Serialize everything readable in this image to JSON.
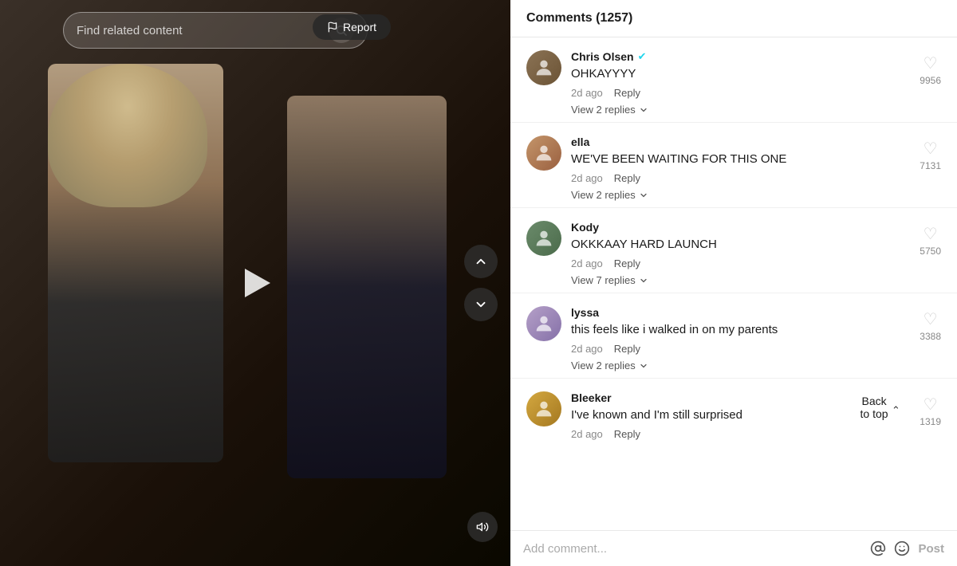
{
  "search": {
    "placeholder": "Find related content"
  },
  "report_button": "Report",
  "comments": {
    "header": "Comments (1257)",
    "list": [
      {
        "id": "chris",
        "username": "Chris Olsen",
        "verified": true,
        "avatar_emoji": "👤",
        "text": "OHKAYYYY",
        "time": "2d ago",
        "reply_label": "Reply",
        "view_replies": "View 2 replies",
        "likes": "9956"
      },
      {
        "id": "ella",
        "username": "ella",
        "verified": false,
        "avatar_emoji": "👤",
        "text": "WE'VE BEEN WAITING FOR THIS ONE",
        "time": "2d ago",
        "reply_label": "Reply",
        "view_replies": "View 2 replies",
        "likes": "7131"
      },
      {
        "id": "kody",
        "username": "Kody",
        "verified": false,
        "avatar_emoji": "👤",
        "text": "OKKKAAY HARD LAUNCH",
        "time": "2d ago",
        "reply_label": "Reply",
        "view_replies": "View 7 replies",
        "likes": "5750"
      },
      {
        "id": "lyssa",
        "username": "lyssa",
        "verified": false,
        "avatar_emoji": "👤",
        "text": "this feels like i walked in on my parents",
        "time": "2d ago",
        "reply_label": "Reply",
        "view_replies": "View 2 replies",
        "likes": "3388"
      },
      {
        "id": "bleeker",
        "username": "Bleeker",
        "verified": false,
        "avatar_emoji": "👤",
        "text": "I've known and I'm still surprised",
        "time": "2d ago",
        "reply_label": "Reply",
        "view_replies": null,
        "likes": "1319"
      }
    ]
  },
  "back_to_top": "Back to top",
  "comment_input_placeholder": "Add comment...",
  "post_label": "Post",
  "nav": {
    "up": "▲",
    "down": "▼"
  }
}
